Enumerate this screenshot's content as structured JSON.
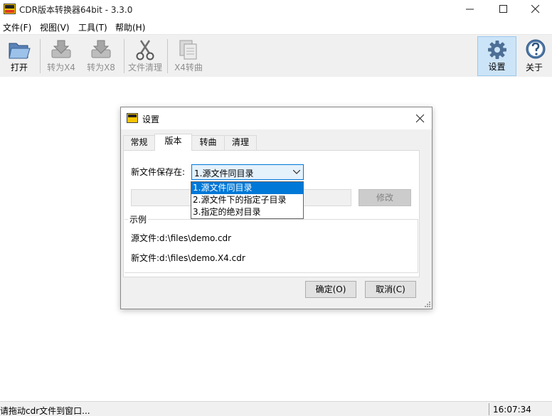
{
  "window": {
    "title": "CDR版本转换器64bit - 3.3.0"
  },
  "menu": [
    {
      "label": "文件(F)"
    },
    {
      "label": "视图(V)"
    },
    {
      "label": "工具(T)"
    },
    {
      "label": "帮助(H)"
    }
  ],
  "toolbar": {
    "open": "打开",
    "to_x4": "转为X4",
    "to_x8": "转为X8",
    "clean": "文件清理",
    "x4_curve": "X4转曲",
    "settings": "设置",
    "about": "关于",
    "active_item": "settings"
  },
  "dialog": {
    "title": "设置",
    "tabs": [
      {
        "label": "常规"
      },
      {
        "label": "版本"
      },
      {
        "label": "转曲"
      },
      {
        "label": "清理"
      }
    ],
    "selected_tab": "版本",
    "save_label": "新文件保存在:",
    "save_value": "1.源文件同目录",
    "options": [
      {
        "label": "1.源文件同目录"
      },
      {
        "label": "2.源文件下的指定子目录"
      },
      {
        "label": "3.指定的绝对目录"
      }
    ],
    "modify_button": "修改",
    "example_title": "示例",
    "source_label": "源文件:",
    "source_path": "d:\\files\\demo.cdr",
    "new_label": "新文件:",
    "new_path": "d:\\files\\demo.X4.cdr",
    "ok_button": "确定(O)",
    "cancel_button": "取消(C)"
  },
  "status": {
    "text": "请拖动cdr文件到窗口...",
    "time": "16:07:34"
  },
  "colors": {
    "accent": "#0078d7",
    "toolbar_bg": "#f0f0f0",
    "active_tool_bg": "#cce4f7"
  }
}
